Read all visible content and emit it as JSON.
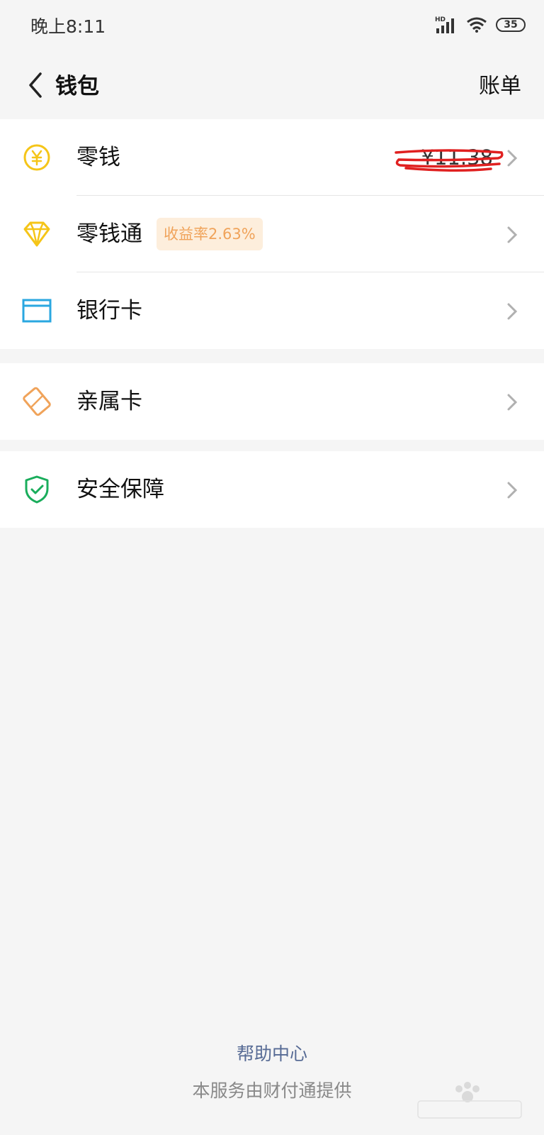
{
  "status_bar": {
    "time": "晚上8:11",
    "network": "HD",
    "battery": "35"
  },
  "header": {
    "title": "钱包",
    "action": "账单"
  },
  "section1": {
    "change": {
      "label": "零钱",
      "amount": "¥11.38",
      "icon": "yen-coin-icon"
    },
    "change_plus": {
      "label": "零钱通",
      "badge": "收益率2.63%",
      "icon": "diamond-icon"
    },
    "bank_card": {
      "label": "银行卡",
      "icon": "card-icon"
    }
  },
  "section2": {
    "family_card": {
      "label": "亲属卡",
      "icon": "family-card-icon"
    }
  },
  "section3": {
    "security": {
      "label": "安全保障",
      "icon": "shield-check-icon"
    }
  },
  "footer": {
    "help": "帮助中心",
    "provider": "本服务由财付通提供"
  },
  "colors": {
    "background": "#f5f5f5",
    "accent_yellow": "#f5c518",
    "accent_blue": "#2aa7e0",
    "accent_orange": "#f0a35a",
    "accent_green": "#1aad5c",
    "link": "#576b95"
  }
}
